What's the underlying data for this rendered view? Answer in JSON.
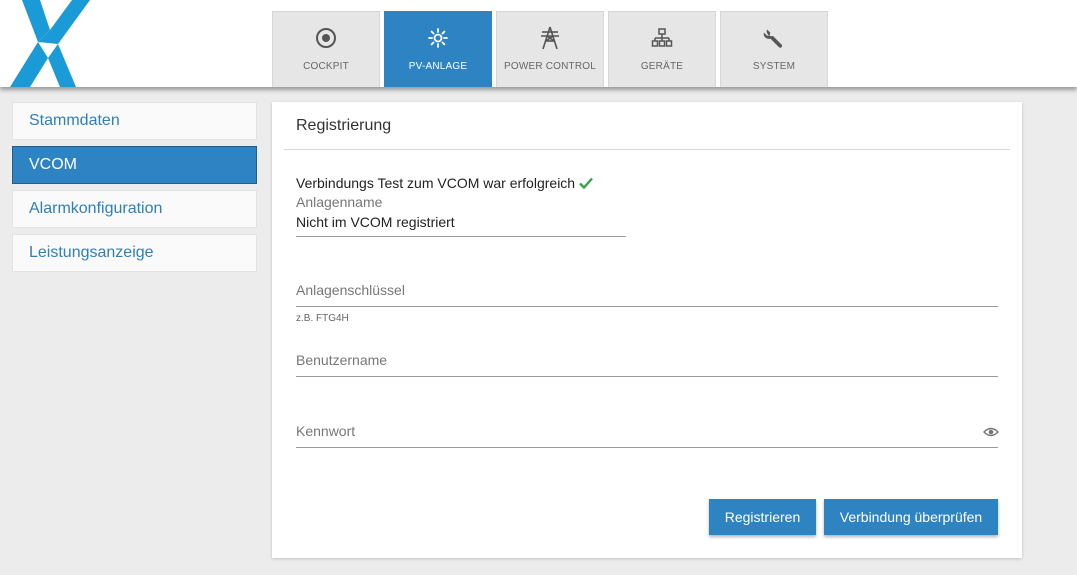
{
  "colors": {
    "accent": "#2e84c3",
    "logo": "#1a9ad6",
    "success": "#3aa04a"
  },
  "nav": {
    "tabs": [
      {
        "label": "COCKPIT",
        "icon": "target-icon"
      },
      {
        "label": "PV-ANLAGE",
        "icon": "sun-icon",
        "active": true
      },
      {
        "label": "POWER CONTROL",
        "icon": "power-tower-icon"
      },
      {
        "label": "GERÄTE",
        "icon": "device-tree-icon"
      },
      {
        "label": "SYSTEM",
        "icon": "wrench-icon"
      }
    ]
  },
  "sidebar": {
    "items": [
      {
        "label": "Stammdaten"
      },
      {
        "label": "VCOM",
        "active": true
      },
      {
        "label": "Alarmkonfiguration"
      },
      {
        "label": "Leistungsanzeige"
      }
    ]
  },
  "main": {
    "title": "Registrierung",
    "success_message": "Verbindungs Test zum VCOM war erfolgreich",
    "plant_name": {
      "label": "Anlagenname",
      "value": "Nicht im VCOM registriert"
    },
    "plant_key": {
      "placeholder": "Anlagenschlüssel",
      "hint": "z.B. FTG4H"
    },
    "username": {
      "placeholder": "Benutzername"
    },
    "password": {
      "placeholder": "Kennwort"
    },
    "buttons": {
      "register": "Registrieren",
      "verify": "Verbindung überprüfen"
    }
  }
}
